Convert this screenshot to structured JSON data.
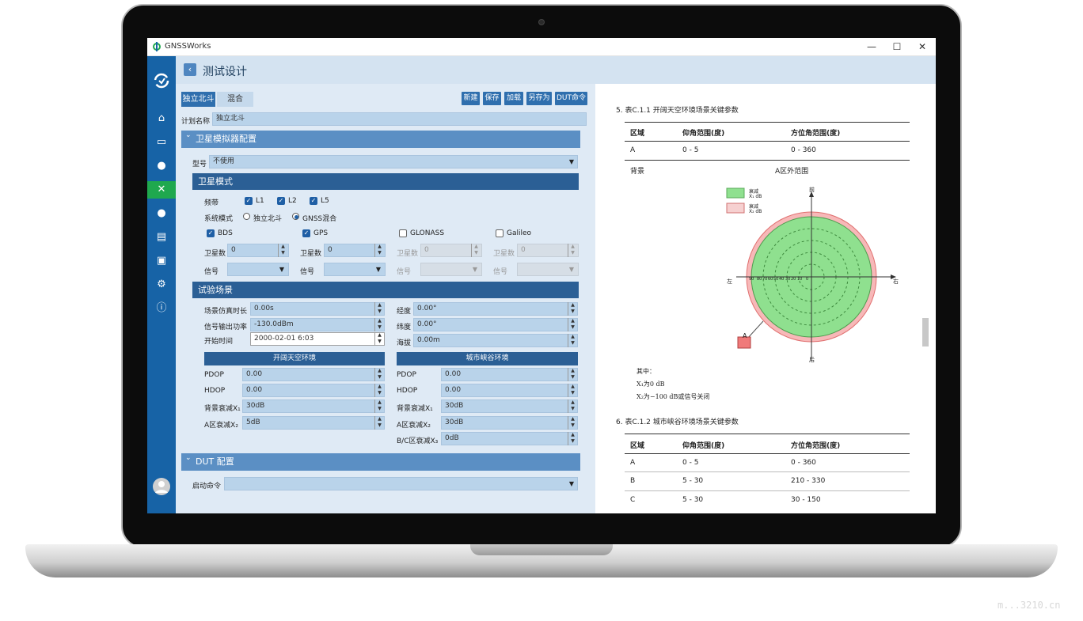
{
  "window": {
    "title": "GNSSWorks",
    "minimize": "—",
    "maximize": "☐",
    "close": "✕"
  },
  "header": {
    "back": "‹",
    "title": "测试设计"
  },
  "tabs": [
    {
      "label": "独立北斗"
    },
    {
      "label": "混合"
    }
  ],
  "toolbar": {
    "new": "新建",
    "save": "保存",
    "load": "加载",
    "save_as": "另存为",
    "dut_cmd": "DUT命令"
  },
  "plan": {
    "label": "计划名称",
    "value": "独立北斗"
  },
  "simulator": {
    "section_title": "卫星模拟器配置",
    "model_label": "型号",
    "model_value": "不使用",
    "sat_mode": {
      "title": "卫星模式",
      "band_label": "频带",
      "bands": [
        "L1",
        "L2",
        "L5"
      ],
      "system_label": "系统模式",
      "system_options": [
        "独立北斗",
        "GNSS混合"
      ],
      "constellations": [
        {
          "name": "BDS",
          "checked": true,
          "count_label": "卫星数",
          "count": "0",
          "signal_label": "信号"
        },
        {
          "name": "GPS",
          "checked": true,
          "count_label": "卫星数",
          "count": "0",
          "signal_label": "信号"
        },
        {
          "name": "GLONASS",
          "checked": false,
          "count_label": "卫星数",
          "count": "0",
          "signal_label": "信号"
        },
        {
          "name": "Galileo",
          "checked": false,
          "count_label": "卫星数",
          "count": "0",
          "signal_label": "信号"
        }
      ]
    },
    "scenario": {
      "title": "试验场景",
      "duration_label": "场景仿真时长",
      "duration": "0.00s",
      "power_label": "信号输出功率",
      "power": "-130.0dBm",
      "start_label": "开始时间",
      "start": "2000-02-01 6:03",
      "lon_label": "经度",
      "lon": "0.00°",
      "lat_label": "纬度",
      "lat": "0.00°",
      "alt_label": "海拔",
      "alt": "0.00m",
      "open_env": {
        "title": "开阔天空环境",
        "pdop_label": "PDOP",
        "pdop": "0.00",
        "hdop_label": "HDOP",
        "hdop": "0.00",
        "bg_label": "背景衰减X₁",
        "bg": "30dB",
        "a_label": "A区衰减X₂",
        "a": "5dB"
      },
      "urban_env": {
        "title": "城市峡谷环境",
        "pdop_label": "PDOP",
        "pdop": "0.00",
        "hdop_label": "HDOP",
        "hdop": "0.00",
        "bg_label": "背景衰减X₁",
        "bg": "30dB",
        "a_label": "A区衰减X₂",
        "a": "30dB",
        "bc_label": "B/C区衰减X₃",
        "bc": "0dB"
      }
    }
  },
  "dut": {
    "section_title": "DUT 配置",
    "start_cmd_label": "启动命令",
    "start_cmd": ""
  },
  "doc": {
    "t1": "5. 表C.1.1 开阔天空环境场景关键参数",
    "headers": [
      "区域",
      "仰角范围(度)",
      "方位角范围(度)"
    ],
    "t1_rows": [
      [
        "A",
        "0 - 5",
        "0 - 360"
      ]
    ],
    "bg_label": "背景",
    "bg_value": "A区外范围",
    "legend": [
      {
        "label": "衰减",
        "sub": "X₁ dB",
        "color": "#8fe08f"
      },
      {
        "label": "衰减",
        "sub": "X₂ dB",
        "color": "#f6c8c8"
      }
    ],
    "dirs": {
      "n": "前",
      "s": "后",
      "w": "左",
      "e": "右"
    },
    "ticks": [
      "90",
      "80",
      "70",
      "60",
      "50",
      "40",
      "30",
      "20",
      "10",
      "0"
    ],
    "marker": "A",
    "note_title": "其中：",
    "note1": "X₁为0  dB",
    "note2": "X₂为−100  dB或信号关闭",
    "t2": "6. 表C.1.2 城市峡谷环境场景关键参数",
    "t2_rows": [
      [
        "A",
        "0 - 5",
        "0 - 360"
      ],
      [
        "B",
        "5 - 30",
        "210 - 330"
      ],
      [
        "C",
        "5 - 30",
        "30 - 150"
      ]
    ]
  },
  "watermark": "m...3210.cn"
}
